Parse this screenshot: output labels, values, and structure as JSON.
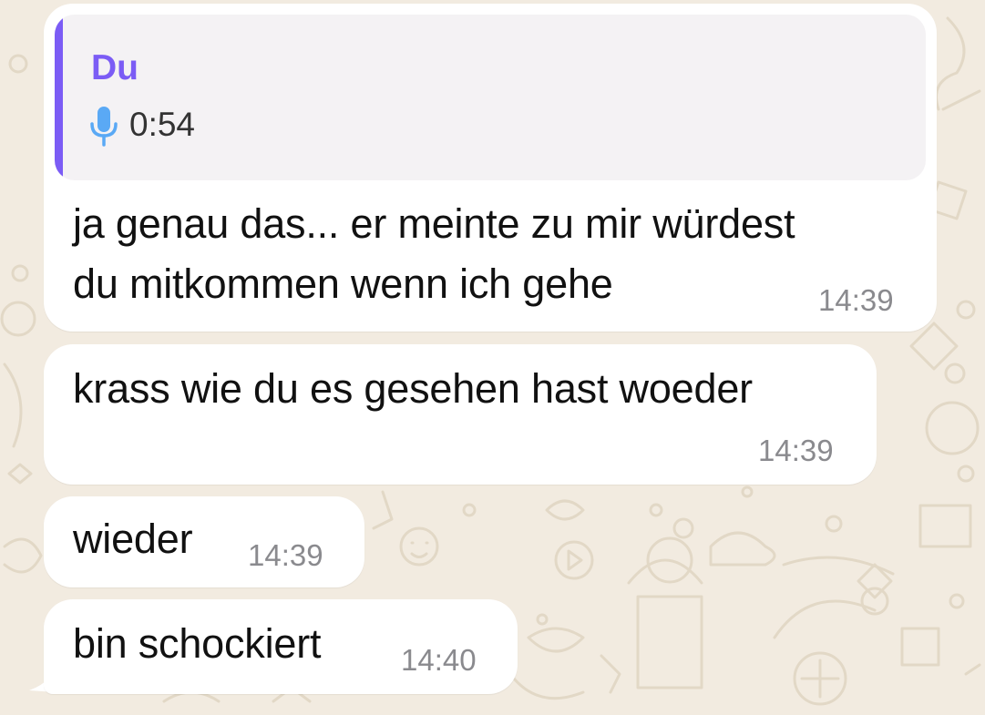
{
  "colors": {
    "wallpaper": "#f2ebe0",
    "bubble": "#ffffff",
    "quote_accent": "#7b5cf5",
    "mic": "#5aa9f5",
    "timestamp": "#8a8a8e"
  },
  "messages": [
    {
      "quote": {
        "author": "Du",
        "icon": "microphone-icon",
        "duration": "0:54"
      },
      "lines": [
        "ja genau das... er meinte zu mir würdest",
        "du mitkommen wenn ich gehe"
      ],
      "time": "14:39"
    },
    {
      "text": "krass wie du es gesehen hast woeder",
      "time": "14:39"
    },
    {
      "text": "wieder",
      "time": "14:39"
    },
    {
      "text": "bin schockiert",
      "time": "14:40"
    }
  ]
}
